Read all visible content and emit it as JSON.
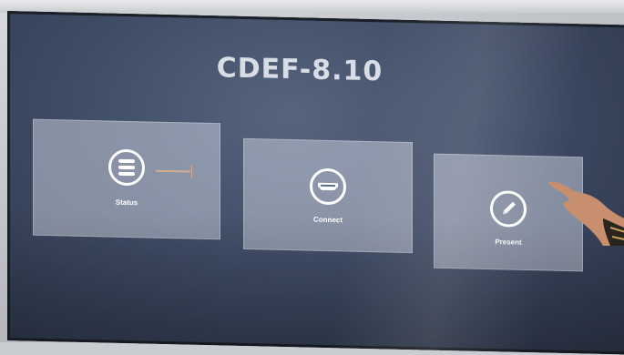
{
  "screen": {
    "title": "CDEF-8.10"
  },
  "tiles": [
    {
      "label": "Status",
      "icon": "stack-icon"
    },
    {
      "label": "Connect",
      "icon": "hdmi-port-icon"
    },
    {
      "label": "Present",
      "icon": "pencil-icon"
    }
  ],
  "colors": {
    "screen_background": "#3f4c65",
    "tile_background": "#c4cbd8",
    "title_text": "#d9dde6",
    "icon_stroke": "#ffffff"
  }
}
